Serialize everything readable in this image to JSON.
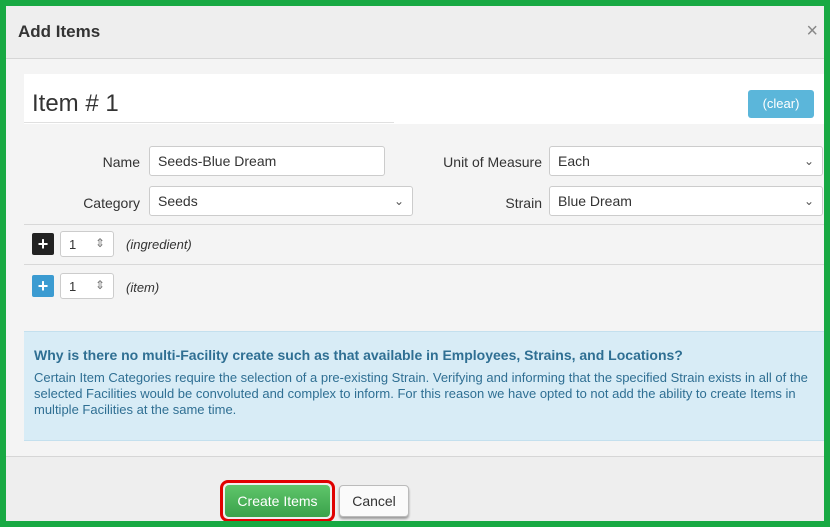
{
  "dialog": {
    "title": "Add Items",
    "close_glyph": "×"
  },
  "item": {
    "heading": "Item # 1",
    "clear_label": "(clear)"
  },
  "form": {
    "name_label": "Name",
    "name_value": "Seeds-Blue Dream",
    "category_label": "Category",
    "category_value": "Seeds",
    "uom_label": "Unit of Measure",
    "uom_value": "Each",
    "strain_label": "Strain",
    "strain_value": "Blue Dream"
  },
  "ingredient_row": {
    "count": "1",
    "label": "(ingredient)"
  },
  "item_row": {
    "count": "1",
    "label": "(item)"
  },
  "info": {
    "title": "Why is there no multi-Facility create such as that available in Employees, Strains, and Locations?",
    "body": "Certain Item Categories require the selection of a pre-existing Strain. Verifying and informing that the specified Strain exists in all of the selected Facilities would be convoluted and complex to inform. For this reason we have opted to not add the ability to create Items in multiple Facilities at the same time."
  },
  "footer": {
    "create_label": "Create Items",
    "cancel_label": "Cancel"
  },
  "colors": {
    "frame_border": "#18a943",
    "accent_blue": "#5bb6da",
    "create_green": "#3aa24a",
    "highlight_red": "#e00000",
    "info_bg": "#d8ecf6",
    "info_text": "#2f6f93"
  },
  "icons": {
    "close": "close-icon",
    "plus": "plus-icon",
    "chevron": "chevron-down-icon",
    "spinner": "spinner-arrows-icon"
  }
}
